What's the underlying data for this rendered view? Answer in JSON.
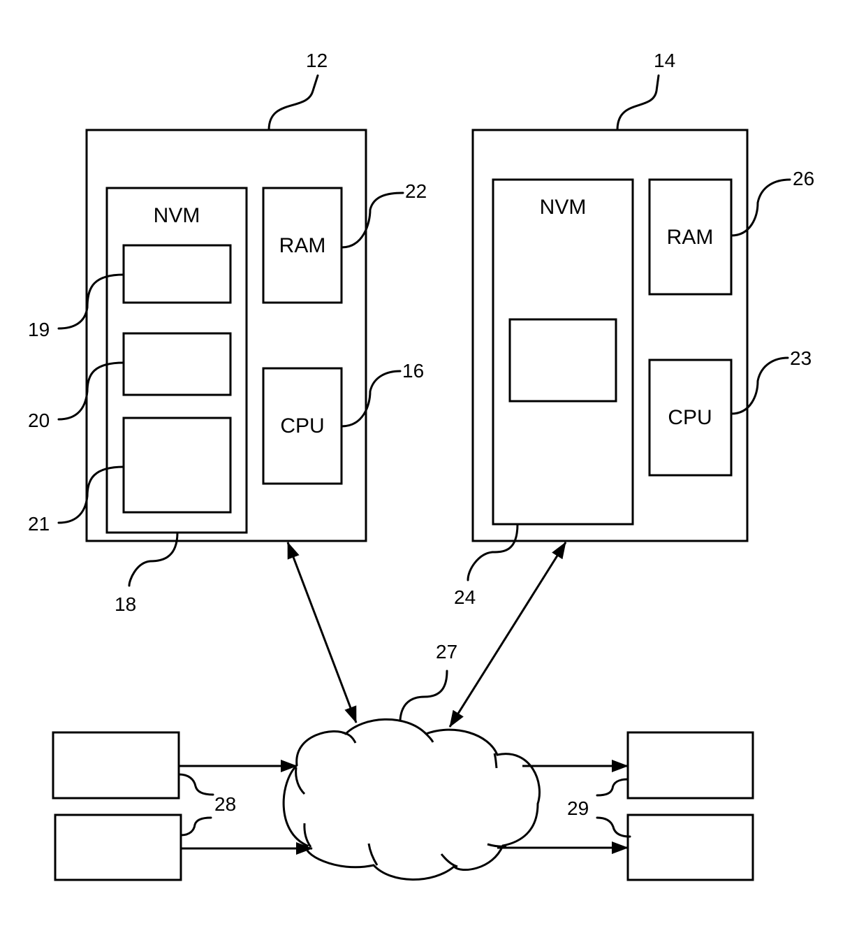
{
  "diagram": {
    "type": "patent-block-diagram",
    "colors": {
      "stroke": "#000000",
      "background": "#ffffff"
    },
    "device_a": {
      "ref": "12",
      "nvm": {
        "ref": "18",
        "label": "NVM",
        "blocks": [
          {
            "ref": "19"
          },
          {
            "ref": "20"
          },
          {
            "ref": "21"
          }
        ]
      },
      "ram": {
        "ref": "22",
        "label": "RAM"
      },
      "cpu": {
        "ref": "16",
        "label": "CPU"
      }
    },
    "device_b": {
      "ref": "14",
      "nvm": {
        "ref": "24",
        "label": "NVM"
      },
      "ram": {
        "ref": "26",
        "label": "RAM"
      },
      "cpu": {
        "ref": "23",
        "label": "CPU"
      }
    },
    "network": {
      "ref": "27",
      "shape": "cloud"
    },
    "sources": {
      "ref": "28",
      "count": 2
    },
    "sinks": {
      "ref": "29",
      "count": 2
    },
    "connections": [
      {
        "from": "12",
        "to": "27",
        "kind": "bidirectional"
      },
      {
        "from": "14",
        "to": "27",
        "kind": "bidirectional"
      },
      {
        "from": "28",
        "to": "27",
        "kind": "one-way"
      },
      {
        "from": "27",
        "to": "29",
        "kind": "one-way"
      }
    ]
  }
}
